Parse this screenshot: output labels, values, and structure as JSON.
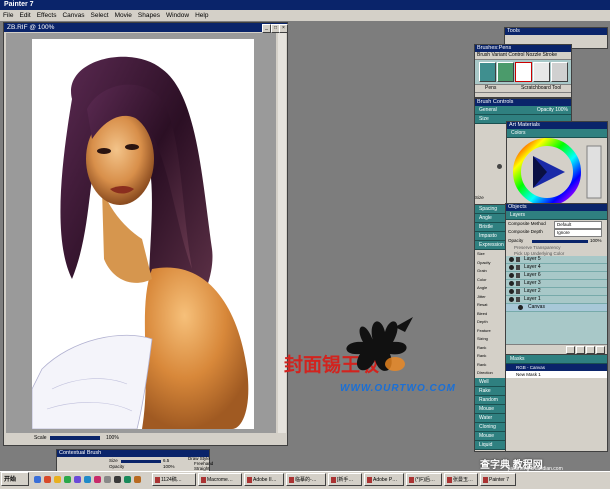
{
  "app": {
    "title": "Painter 7"
  },
  "menu": [
    "File",
    "Edit",
    "Effects",
    "Canvas",
    "Select",
    "Movie",
    "Shapes",
    "Window",
    "Help"
  ],
  "document": {
    "title": "ZB.RIF @ 100%",
    "scale_label": "Scale",
    "zoom": "100%"
  },
  "tools_palette": {
    "title": "Tools"
  },
  "brushes_palette": {
    "title": "Brushes:Pens",
    "tabs": [
      "Brush",
      "Variant",
      "Control",
      "Nozzle",
      "Stroke"
    ],
    "footer_left": "Pens",
    "footer_right": "Scratchboard Tool"
  },
  "brush_controls": {
    "title": "Brush Controls",
    "general": "General",
    "opacity_label": "Opacity",
    "opacity_value": "100%",
    "size": "Size",
    "fields": [
      "Size",
      "Min Size",
      "Size Step",
      "Feature"
    ]
  },
  "art_materials": {
    "title": "Art Materials",
    "colors": "Colors"
  },
  "side_sections": [
    "Spacing",
    "Angle",
    "Bristle",
    "Impasto",
    "Expression"
  ],
  "side_fields": [
    "Size",
    "Opacity",
    "Grain",
    "Color",
    "Angle",
    "Jitter",
    "Resat",
    "Bleed",
    "Depth",
    "Feature",
    "Sizing",
    "Rank",
    "Rank",
    "Rank",
    "Direction"
  ],
  "side_sections_bottom": [
    "Well",
    "Rake",
    "Random",
    "Mouse",
    "Water",
    "Cloning",
    "Mouse",
    "Liquid"
  ],
  "objects": {
    "title": "Objects",
    "layers_tab": "Layers",
    "composite_method_label": "Composite Method",
    "composite_method": "Default",
    "composite_depth_label": "Composite Depth",
    "composite_depth": "Ignore",
    "opacity_label": "Opacity",
    "opacity_value": "100%",
    "preserve": "Preserve Transparency",
    "pick_up": "Pick Up Underlying Color",
    "layers": [
      "Layer 5",
      "Layer 4",
      "Layer 6",
      "Layer 3",
      "Layer 2",
      "Layer 1"
    ],
    "canvas_row": "Canvas"
  },
  "masks": {
    "title": "Masks",
    "rows": [
      "RGB - Canvas",
      "New Mask 1"
    ]
  },
  "contextual_brush": {
    "title": "Contextual Brush",
    "draw_style_label": "Draw Style",
    "draw_style": "Freehand",
    "size_label": "Size",
    "size_value": "6.5",
    "opacity_label": "Opacity",
    "opacity_value": "100%",
    "straight": "Straight"
  },
  "watermark": {
    "chinese": "封面锡王坂",
    "url": "WWW.OURTWO.COM",
    "site": "查字典 教程网",
    "site_url": "jiaocheng.chazidian.com"
  },
  "taskbar": {
    "start": "开始",
    "tasks": [
      "1124稿…",
      "Macrome…",
      "Adobe II…",
      "临摹的-…",
      "[新手…",
      "Adobe P…",
      "(*)F)后…",
      "张曼玉…",
      "Painter 7"
    ]
  },
  "colors": {
    "accent": "#0a246a",
    "teal": "#2f8080",
    "desktop": "#7d7d7d"
  }
}
